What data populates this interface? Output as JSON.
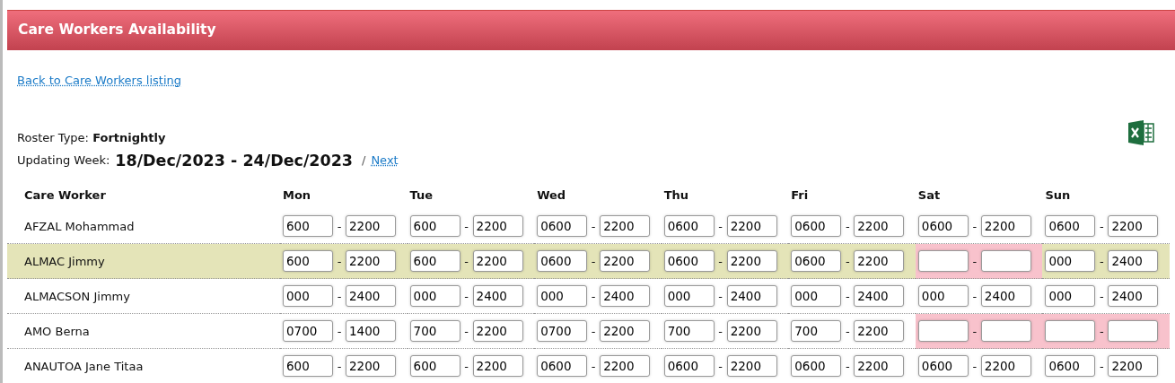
{
  "header": {
    "title": "Care Workers Availability"
  },
  "back_link": "Back to Care Workers listing",
  "roster": {
    "label": "Roster Type:",
    "value": "Fortnightly"
  },
  "week": {
    "label": "Updating Week:",
    "range": "18/Dec/2023 - 24/Dec/2023",
    "separator": "/",
    "next": "Next"
  },
  "table": {
    "columns": [
      "Care Worker",
      "Mon",
      "Tue",
      "Wed",
      "Thu",
      "Fri",
      "Sat",
      "Sun"
    ],
    "rows": [
      {
        "name": "AFZAL Mohammad",
        "selected": false,
        "days": [
          {
            "start": "600",
            "end": "2200"
          },
          {
            "start": "600",
            "end": "2200"
          },
          {
            "start": "0600",
            "end": "2200"
          },
          {
            "start": "0600",
            "end": "2200"
          },
          {
            "start": "0600",
            "end": "2200"
          },
          {
            "start": "0600",
            "end": "2200"
          },
          {
            "start": "0600",
            "end": "2200"
          }
        ]
      },
      {
        "name": "ALMAC Jimmy",
        "selected": true,
        "days": [
          {
            "start": "600",
            "end": "2200"
          },
          {
            "start": "600",
            "end": "2200"
          },
          {
            "start": "0600",
            "end": "2200"
          },
          {
            "start": "0600",
            "end": "2200"
          },
          {
            "start": "0600",
            "end": "2200"
          },
          {
            "unavailable": true
          },
          {
            "start": "000",
            "end": "2400"
          }
        ]
      },
      {
        "name": "ALMACSON Jimmy",
        "selected": false,
        "days": [
          {
            "start": "000",
            "end": "2400"
          },
          {
            "start": "000",
            "end": "2400"
          },
          {
            "start": "000",
            "end": "2400"
          },
          {
            "start": "000",
            "end": "2400"
          },
          {
            "start": "000",
            "end": "2400"
          },
          {
            "start": "000",
            "end": "2400"
          },
          {
            "start": "000",
            "end": "2400"
          }
        ]
      },
      {
        "name": "AMO Berna",
        "selected": false,
        "days": [
          {
            "start": "0700",
            "end": "1400"
          },
          {
            "start": "700",
            "end": "2200"
          },
          {
            "start": "0700",
            "end": "2200"
          },
          {
            "start": "700",
            "end": "2200"
          },
          {
            "start": "700",
            "end": "2200"
          },
          {
            "unavailable": true
          },
          {
            "unavailable": true
          }
        ]
      },
      {
        "name": "ANAUTOA Jane Titaa",
        "selected": false,
        "days": [
          {
            "start": "600",
            "end": "2200"
          },
          {
            "start": "600",
            "end": "2200"
          },
          {
            "start": "0600",
            "end": "2200"
          },
          {
            "start": "0600",
            "end": "2200"
          },
          {
            "start": "0600",
            "end": "2200"
          },
          {
            "start": "0600",
            "end": "2200"
          },
          {
            "start": "0600",
            "end": "2200"
          }
        ]
      }
    ],
    "dash": "-"
  }
}
